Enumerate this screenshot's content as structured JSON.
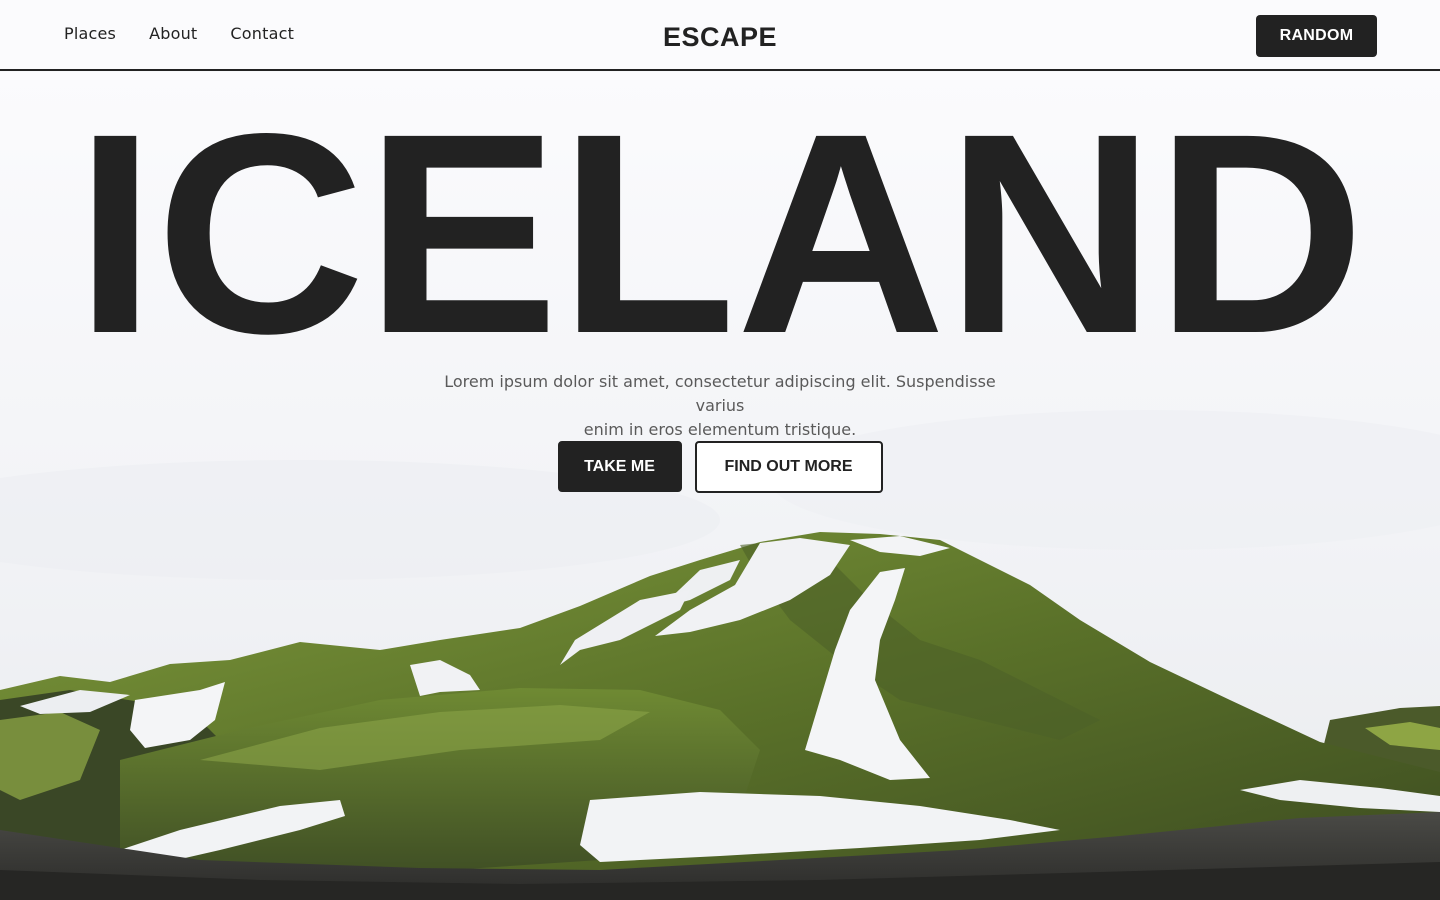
{
  "header": {
    "nav": [
      {
        "label": "Places"
      },
      {
        "label": "About"
      },
      {
        "label": "Contact"
      }
    ],
    "logo": "ESCAPE",
    "random_label": "RANDOM"
  },
  "hero": {
    "headline": "ICELAND",
    "subtitle_line1": "Lorem ipsum dolor sit amet, consectetur adipiscing elit. Suspendisse varius",
    "subtitle_line2": "enim in eros elementum tristique.",
    "primary_label": "TAKE ME",
    "secondary_label": "FIND OUT MORE"
  },
  "colors": {
    "ink": "#222222",
    "background": "#f7f8fa",
    "moss": "#5f7a2e",
    "snow": "#f2f3f5"
  }
}
